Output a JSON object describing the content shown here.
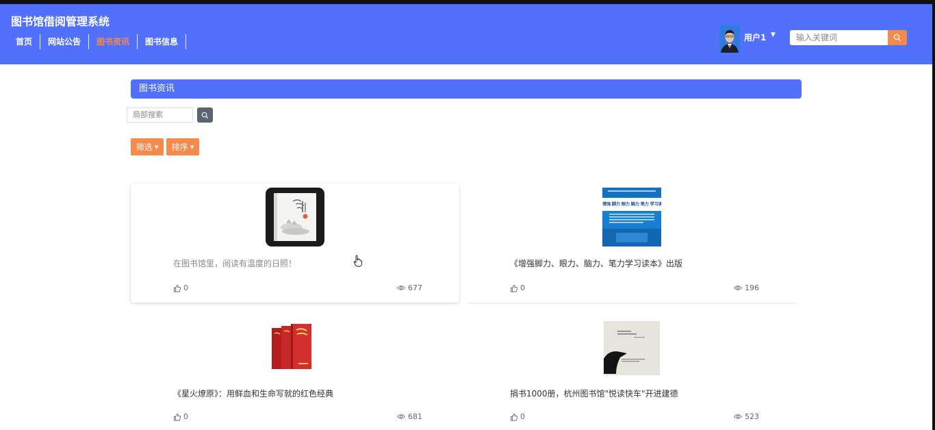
{
  "app": {
    "title": "图书馆借阅管理系统"
  },
  "nav": [
    {
      "label": "首页"
    },
    {
      "label": "网站公告"
    },
    {
      "label": "图书资讯",
      "active": true
    },
    {
      "label": "图书信息"
    }
  ],
  "user": {
    "name": "用户1"
  },
  "header_search": {
    "placeholder": "输入关键词"
  },
  "section": {
    "title": "图书资讯"
  },
  "local_search": {
    "placeholder": "局部搜索"
  },
  "filters": {
    "filter_label": "筛选",
    "sort_label": "排序"
  },
  "articles": [
    {
      "title": "在图书馆里，阅读有温度的日照！",
      "likes": "0",
      "views": "677"
    },
    {
      "title": "《增强脚力、眼力、脑力、笔力学习读本》出版",
      "likes": "0",
      "views": "196"
    },
    {
      "title": "《星火燎原》：用鲜血和生命写就的红色经典",
      "likes": "0",
      "views": "681"
    },
    {
      "title": "捐书1000册，杭州图书馆\"悦读快车\"开进建德",
      "likes": "0",
      "views": "523"
    }
  ],
  "thumb_texts": {
    "book2_band": "增强 脚力 眼力 脑力 笔力 学习读本"
  },
  "colors": {
    "header_bg": "#5170fc",
    "accent_orange": "#f58a4b",
    "active_nav": "#f58a4b",
    "search_btn_gray": "#5b6470"
  },
  "icons": {
    "search": "search-icon",
    "like": "thumbs-up-icon",
    "views": "eye-icon",
    "dropdown": "caret-down-icon"
  }
}
